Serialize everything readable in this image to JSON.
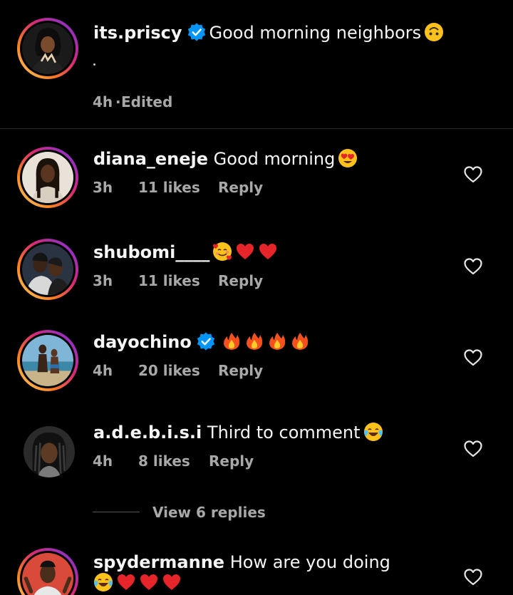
{
  "post": {
    "username": "its.priscy",
    "caption": "Good morning neighbors",
    "caption_emoji": "upside-down-face",
    "time": "4h",
    "edited": "Edited",
    "separator": "·"
  },
  "comments": [
    {
      "username": "diana_eneje",
      "text": "Good morning",
      "emoji": [
        "heart-eyes"
      ],
      "time": "3h",
      "likes": "11 likes",
      "reply": "Reply",
      "verified": false,
      "story_ring": true
    },
    {
      "username": "shubomi____",
      "text": "",
      "emoji": [
        "smiling-face-with-hearts",
        "red-heart",
        "red-heart"
      ],
      "time": "3h",
      "likes": "11 likes",
      "reply": "Reply",
      "verified": false,
      "story_ring": true
    },
    {
      "username": "dayochino",
      "text": "",
      "emoji": [
        "fire",
        "fire",
        "fire",
        "fire"
      ],
      "time": "4h",
      "likes": "20 likes",
      "reply": "Reply",
      "verified": true,
      "story_ring": true
    },
    {
      "username": "a.d.e.b.i.s.i",
      "text": "Third to comment",
      "emoji": [
        "tears-of-joy"
      ],
      "time": "4h",
      "likes": "8 likes",
      "reply": "Reply",
      "verified": false,
      "story_ring": false,
      "view_replies": "View 6 replies"
    },
    {
      "username": "spydermanne",
      "text": "How are you doing",
      "emoji": [
        "tears-of-joy",
        "red-heart",
        "red-heart",
        "red-heart"
      ],
      "verified": false,
      "story_ring": true
    }
  ],
  "colors": {
    "background": "#000000",
    "text": "#f5f5f5",
    "secondary_text": "#a8a8a8",
    "verified_blue": "#0095f6",
    "divider": "#262626"
  }
}
